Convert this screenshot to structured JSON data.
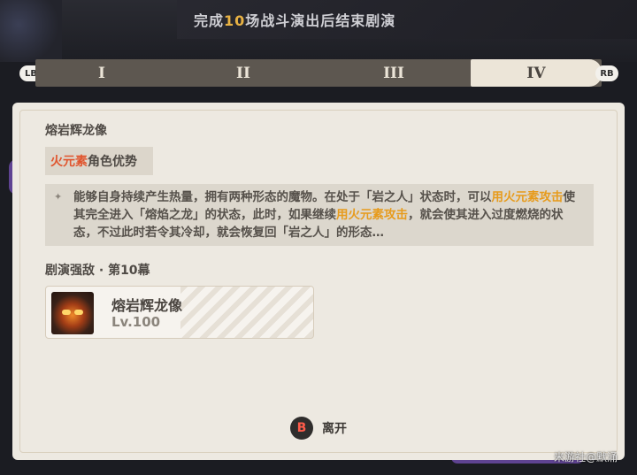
{
  "banner": {
    "prefix": "完成",
    "count": "10",
    "suffix": "场战斗演出后结束剧演"
  },
  "tabs": [
    {
      "label": "I",
      "active": false
    },
    {
      "label": "II",
      "active": false
    },
    {
      "label": "III",
      "active": false
    },
    {
      "label": "IV",
      "active": true
    }
  ],
  "controller": {
    "left_bumper": "LB",
    "right_bumper": "RB",
    "leave_key": "B"
  },
  "enemy": {
    "title": "熔岩辉龙像",
    "element_name": "火元素",
    "element_suffix": "角色优势",
    "description": {
      "part1": "能够自身持续产生热量，拥有两种形态的魔物。在处于「岩之人」状态时，可以",
      "hl1": "用火元素攻击",
      "part2": "使其完全进入「熔焰之龙」的状态，此时，如果继续",
      "hl2": "用火元素攻击",
      "part3": "，就会使其进入过度燃烧的状态，不过此时若令其冷却，就会恢复回「岩之人」的形态…"
    }
  },
  "stage": {
    "label": "剧演强敌 · 第10幕"
  },
  "enemy_card": {
    "name": "熔岩辉龙像",
    "level": "Lv.100"
  },
  "leave": {
    "label": "离开"
  },
  "watermark": "米游社@默涌",
  "colors": {
    "accent_orange": "#e79b1c",
    "fire": "#e0552e",
    "tab_active_bg": "#ece5d8",
    "card_bg": "#ede9e1"
  }
}
